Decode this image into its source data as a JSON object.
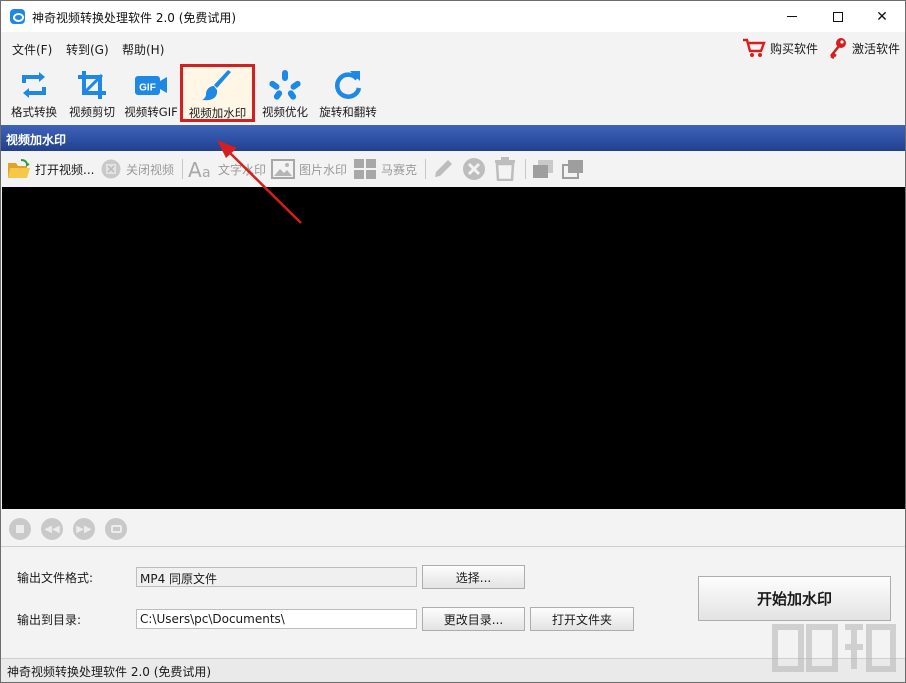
{
  "window": {
    "title": "神奇视频转换处理软件 2.0 (免费试用)"
  },
  "menu": {
    "items": [
      "文件(F)",
      "转到(G)",
      "帮助(H)"
    ],
    "buy_label": "购买软件",
    "activate_label": "激活软件"
  },
  "toolbar": {
    "items": [
      {
        "label": "格式转换",
        "icon": "convert-icon"
      },
      {
        "label": "视频剪切",
        "icon": "crop-icon"
      },
      {
        "label": "视频转GIF",
        "icon": "gif-icon"
      },
      {
        "label": "视频加水印",
        "icon": "brush-icon",
        "active": true
      },
      {
        "label": "视频优化",
        "icon": "optimize-icon"
      },
      {
        "label": "旋转和翻转",
        "icon": "rotate-icon"
      }
    ]
  },
  "section": {
    "title": "视频加水印"
  },
  "edit_toolbar": {
    "open": "打开视频...",
    "close": "关闭视频",
    "text_wm": "文字水印",
    "image_wm": "图片水印",
    "mosaic": "马赛克"
  },
  "output": {
    "format_label": "输出文件格式:",
    "format_value": "MP4 同原文件",
    "select_button": "选择...",
    "dir_label": "输出到目录:",
    "dir_value": "C:\\Users\\pc\\Documents\\",
    "change_dir_button": "更改目录...",
    "open_folder_button": "打开文件夹",
    "start_button": "开始加水印"
  },
  "status": {
    "text": "神奇视频转换处理软件 2.0 (免费试用)"
  },
  "colors": {
    "header_blue": "#2c4fa2",
    "highlight_red": "#d51f1f",
    "icon_blue": "#1e88e5"
  }
}
